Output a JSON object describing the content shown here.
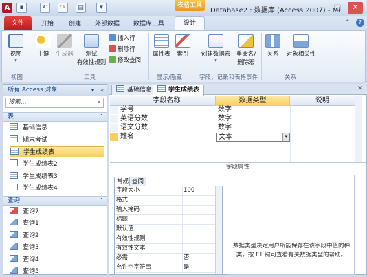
{
  "window": {
    "context_tab": "表格工具",
    "title": "Database2 : 数据库 (Access 2007) - Mi",
    "minimize": "–",
    "restore": "□",
    "close": "✕"
  },
  "ribbon_tabs": [
    {
      "label": "文件"
    },
    {
      "label": "开始"
    },
    {
      "label": "创建"
    },
    {
      "label": "外部数据"
    },
    {
      "label": "数据库工具"
    },
    {
      "label": "设计"
    }
  ],
  "ribbon": {
    "groups": [
      {
        "label": "视图"
      },
      {
        "label": "工具"
      },
      {
        "label": "显示/隐藏"
      },
      {
        "label": "字段、记录和表格事件"
      },
      {
        "label": "关系"
      }
    ],
    "buttons": {
      "view": "视图",
      "primary_key": "主键",
      "builder": "生成器",
      "test_rules_1": "测试",
      "test_rules_2": "有效性规则",
      "insert_rows": "插入行",
      "delete_rows": "删除行",
      "modify_lookups": "修改查阅",
      "property_sheet": "属性表",
      "indexes": "索引",
      "create_macros": "创建数据宏",
      "rename_delete_macro_1": "重命名/",
      "rename_delete_macro_2": "删除宏",
      "relationships": "关系",
      "object_dependencies": "对象相关性"
    }
  },
  "nav": {
    "header": "所有 Access 对象",
    "search_placeholder": "搜索...",
    "sections": [
      {
        "label": "表"
      },
      {
        "label": "查询"
      }
    ],
    "tables": [
      "基础信息",
      "期末考试",
      "学生成绩表",
      "学生成绩表2",
      "学生成绩表3",
      "学生成绩表4"
    ],
    "queries": [
      "查询7",
      "查询1",
      "查询2",
      "查询3",
      "查询4",
      "查询5"
    ]
  },
  "doc_tabs": [
    {
      "label": "基础信息"
    },
    {
      "label": "学生成绩表"
    }
  ],
  "grid": {
    "headers": [
      "字段名称",
      "数据类型",
      "说明"
    ],
    "rows": [
      {
        "name": "学号",
        "type": "数字"
      },
      {
        "name": "英语分数",
        "type": "数字"
      },
      {
        "name": "语文分数",
        "type": "数字"
      },
      {
        "name": "姓名",
        "type": "文本"
      }
    ]
  },
  "field_properties": {
    "label": "字段属性",
    "tabs": [
      "常规",
      "查阅"
    ],
    "rows": [
      {
        "name": "字段大小",
        "value": "100"
      },
      {
        "name": "格式",
        "value": ""
      },
      {
        "name": "输入掩码",
        "value": ""
      },
      {
        "name": "标题",
        "value": ""
      },
      {
        "name": "默认值",
        "value": ""
      },
      {
        "name": "有效性规则",
        "value": ""
      },
      {
        "name": "有效性文本",
        "value": ""
      },
      {
        "name": "必需",
        "value": "否"
      },
      {
        "name": "允许空字符串",
        "value": "是"
      }
    ],
    "help": "数据类型决定用户所能保存在该字段中值的种类。按 F1 键可查看有关数据类型的帮助。"
  }
}
